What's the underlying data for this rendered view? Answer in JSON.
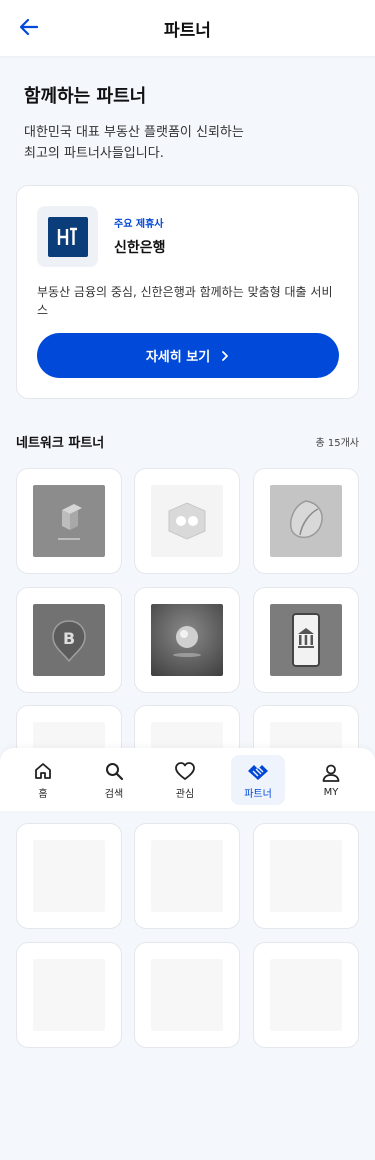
{
  "header": {
    "title": "파트너"
  },
  "intro": {
    "title": "함께하는 파트너",
    "description": "대한민국 대표 부동산 플랫폼이 신뢰하는\n최고의 파트너사들입니다."
  },
  "featured": {
    "tag": "주요 제휴사",
    "name": "신한은행",
    "description": "부동산 금융의 중심, 신한은행과 함께하는 맞춤형 대출 서비스",
    "button_label": "자세히 보기",
    "logo_icon": "bank-logo-icon",
    "accent_color": "#0049d9"
  },
  "network": {
    "title": "네트워크 파트너",
    "count": "총 15개사",
    "partners": [
      {
        "icon": "cube-logo-icon"
      },
      {
        "icon": "hexagon-logo-icon"
      },
      {
        "icon": "leaf-logo-icon"
      },
      {
        "icon": "b-pin-logo-icon"
      },
      {
        "icon": "sphere-logo-icon"
      },
      {
        "icon": "mobile-bank-logo-icon"
      }
    ]
  },
  "bottom_nav": {
    "items": [
      {
        "label": "홈",
        "icon": "home-icon",
        "active": false
      },
      {
        "label": "검색",
        "icon": "search-icon",
        "active": false
      },
      {
        "label": "관심",
        "icon": "heart-icon",
        "active": false
      },
      {
        "label": "파트너",
        "icon": "handshake-icon",
        "active": true
      },
      {
        "label": "MY",
        "icon": "user-icon",
        "active": false
      }
    ]
  }
}
